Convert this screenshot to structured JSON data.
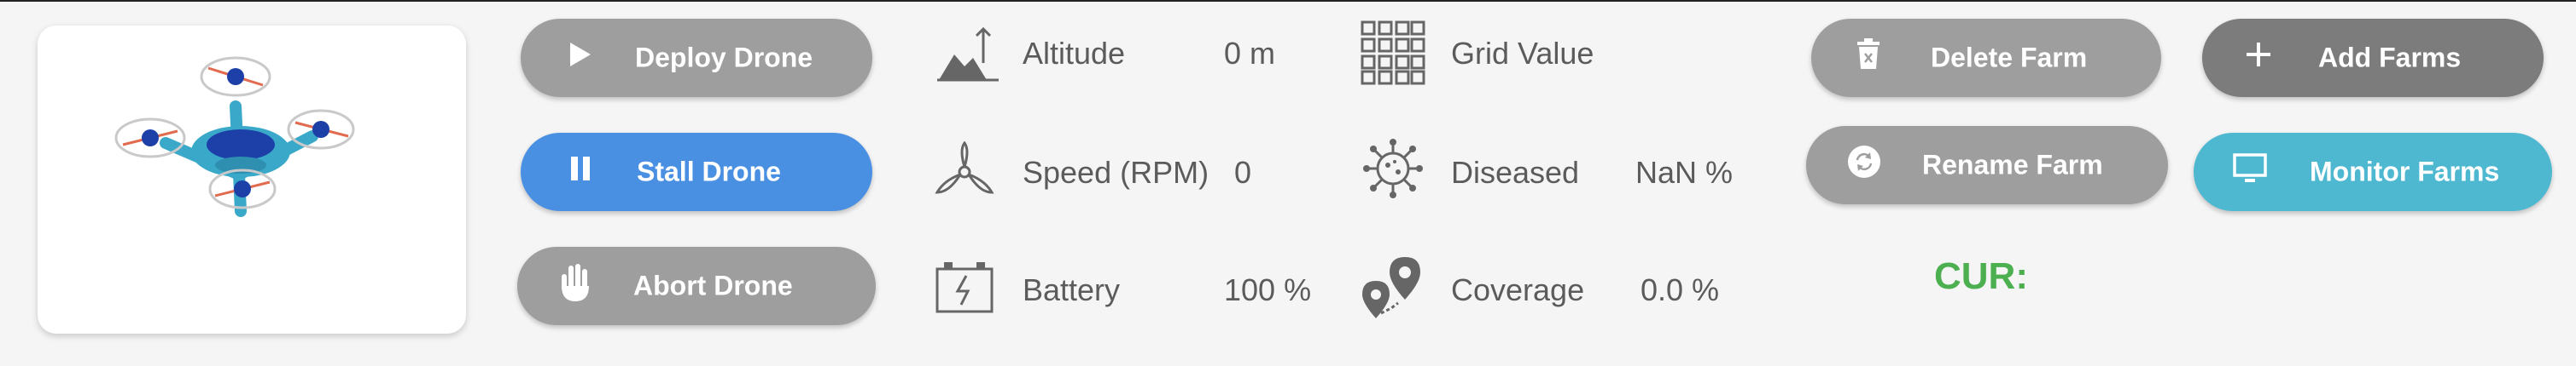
{
  "drone_card": {
    "image_alt": "quadcopter drone"
  },
  "controls": {
    "deploy_label": "Deploy Drone",
    "stall_label": "Stall Drone",
    "abort_label": "Abort Drone"
  },
  "stats": {
    "altitude_label": "Altitude",
    "altitude_value": "0 m",
    "speed_label": "Speed (RPM)",
    "speed_value": "0",
    "battery_label": "Battery",
    "battery_value": "100 %",
    "grid_label": "Grid Value",
    "diseased_label": "Diseased",
    "diseased_value": "NaN %",
    "coverage_label": "Coverage",
    "coverage_value": "0.0 %"
  },
  "farm_actions": {
    "delete_label": "Delete Farm",
    "rename_label": "Rename Farm",
    "add_label": "Add Farms",
    "monitor_label": "Monitor Farms"
  },
  "status": {
    "cur_label": "CUR:"
  },
  "colors": {
    "grey_button": "#9e9e9e",
    "dark_grey_button": "#7c7c7c",
    "blue_button": "#4a90e2",
    "teal_button": "#4fb8d1",
    "cur_green": "#4caf50"
  }
}
